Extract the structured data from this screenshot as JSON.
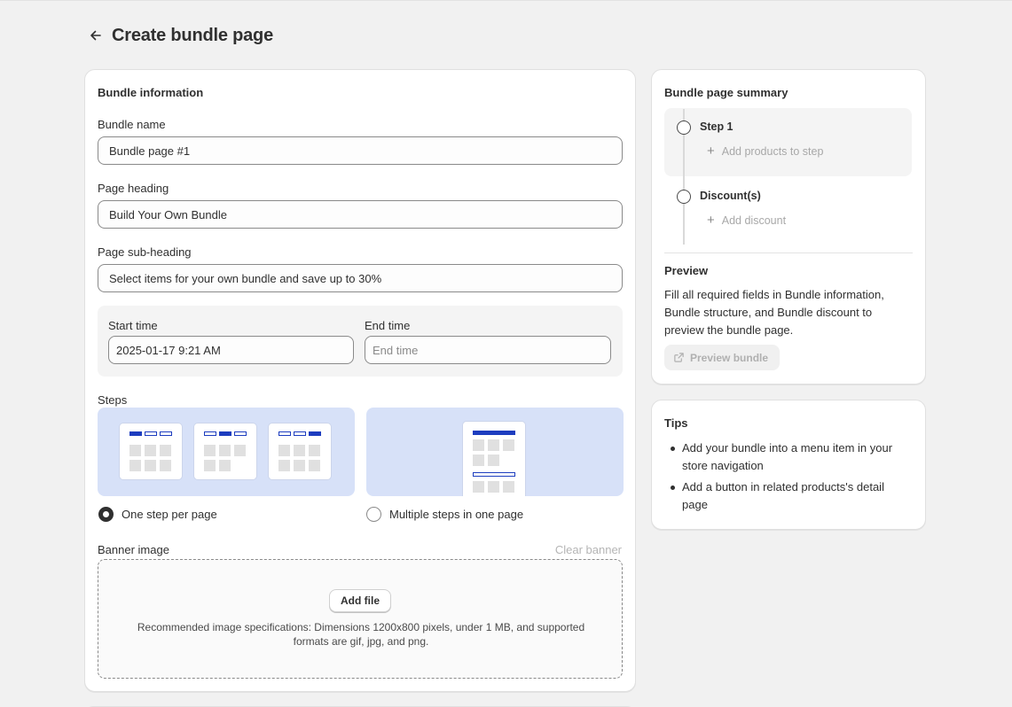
{
  "header": {
    "title": "Create bundle page",
    "back_icon": "arrow-left-icon"
  },
  "bundle_info": {
    "section_title": "Bundle information",
    "bundle_name": {
      "label": "Bundle name",
      "value": "Bundle page #1"
    },
    "page_heading": {
      "label": "Page heading",
      "value": "Build Your Own Bundle"
    },
    "page_subheading": {
      "label": "Page sub-heading",
      "value": "Select items for your own bundle and save up to 30%"
    },
    "start_time": {
      "label": "Start time",
      "value": "2025-01-17 9:21 AM"
    },
    "end_time": {
      "label": "End time",
      "placeholder": "End time"
    },
    "steps": {
      "label": "Steps",
      "options": [
        {
          "label": "One step per page",
          "selected": true
        },
        {
          "label": "Multiple steps in one page",
          "selected": false
        }
      ]
    },
    "banner": {
      "label": "Banner image",
      "clear_label": "Clear banner",
      "add_file_label": "Add file",
      "hint": "Recommended image specifications: Dimensions 1200x800 pixels, under 1 MB, and supported formats are gif, jpg, and png."
    }
  },
  "summary": {
    "title": "Bundle page summary",
    "step1": {
      "title": "Step 1",
      "add_label": "Add products to step"
    },
    "discount": {
      "title": "Discount(s)",
      "add_label": "Add discount"
    },
    "preview": {
      "title": "Preview",
      "text": "Fill all required fields in Bundle information, Bundle structure, and Bundle discount to preview the bundle page.",
      "button_label": "Preview bundle",
      "button_icon": "external-link-icon"
    }
  },
  "tips": {
    "title": "Tips",
    "items": [
      "Add your bundle into a menu item in your store navigation",
      "Add a button in related products's detail page"
    ]
  },
  "colors": {
    "accent": "#1d3dbf",
    "step_card_bg": "#d7e1f8",
    "page_bg": "#f1f1f1"
  }
}
